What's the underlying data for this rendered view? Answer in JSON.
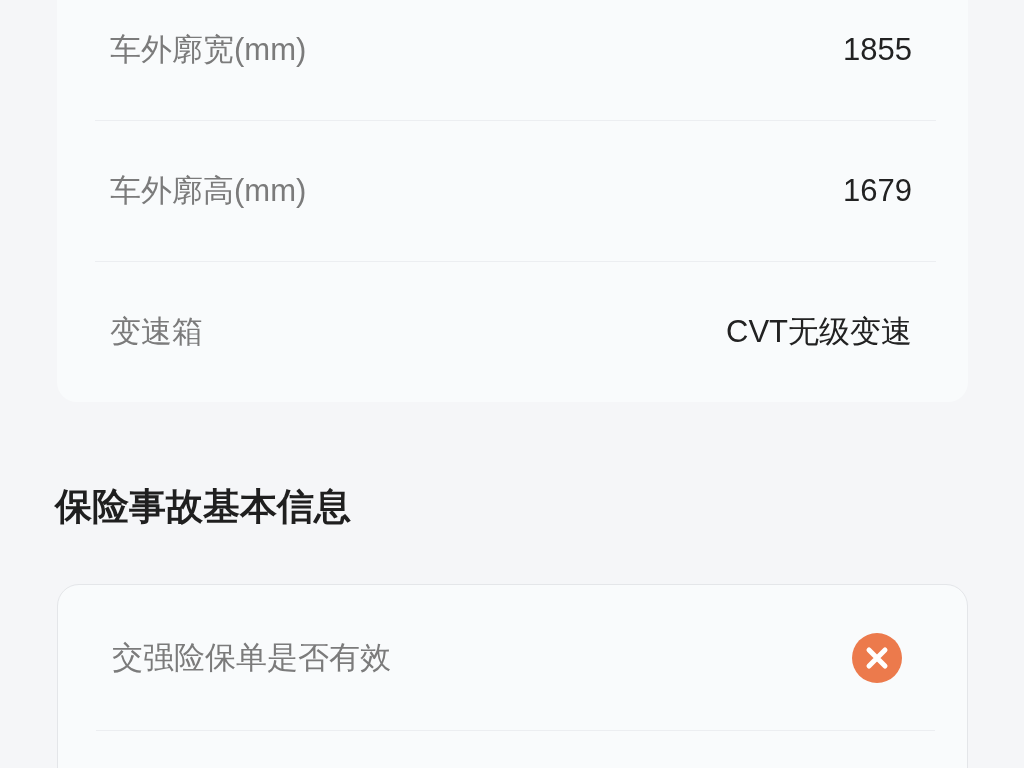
{
  "vehicle_specs": {
    "rows": [
      {
        "label": "车外廓宽(mm)",
        "value": "1855"
      },
      {
        "label": "车外廓高(mm)",
        "value": "1679"
      },
      {
        "label": "变速箱",
        "value": "CVT无级变速"
      }
    ]
  },
  "insurance_section": {
    "title": "保险事故基本信息",
    "rows": [
      {
        "label": "交强险保单是否有效",
        "valid": false
      }
    ]
  }
}
